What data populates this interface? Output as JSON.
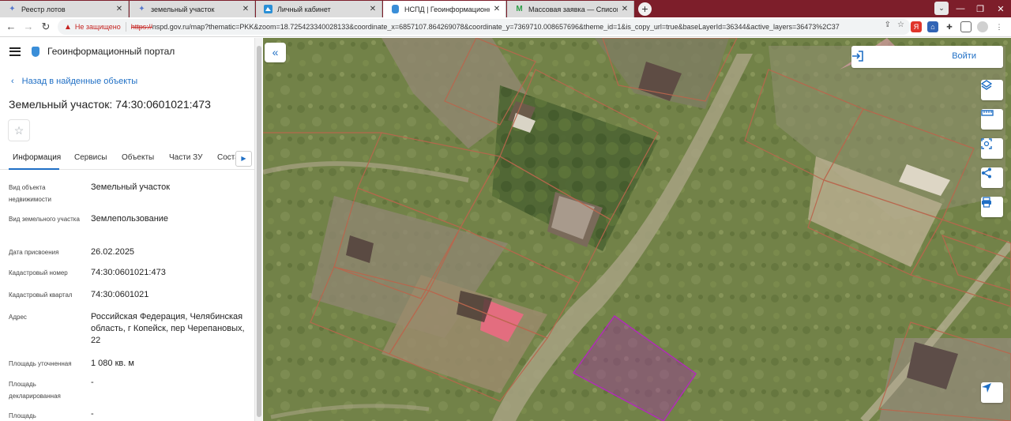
{
  "browser": {
    "tabs": [
      {
        "title": "Реестр лотов",
        "icon": "globe-icon",
        "active": false
      },
      {
        "title": "земельный участок",
        "icon": "globe-icon",
        "active": false
      },
      {
        "title": "Личный кабинет",
        "icon": "cabinet-icon",
        "active": false
      },
      {
        "title": "НСПД | Геоинформационный п",
        "icon": "portal-icon",
        "active": true
      },
      {
        "title": "Массовая заявка — Список зая",
        "icon": "gmail-icon",
        "active": false
      }
    ],
    "new_tab": "+",
    "tab_close": "✕",
    "address": {
      "security_label": "Не защищено",
      "url_scheme": "https://",
      "url_rest": "nspd.gov.ru/map?thematic=PKK&zoom=18.725423340028133&coordinate_x=6857107.864269078&coordinate_y=7369710.008657696&theme_id=1&is_copy_url=true&baseLayerId=36344&active_layers=36473%2C37"
    }
  },
  "portal": {
    "title": "Геоинформационный портал",
    "back_link": "Назад в найденные объекты",
    "object_title": "Земельный участок: 74:30:0601021:473",
    "tabs": [
      "Информация",
      "Сервисы",
      "Объекты",
      "Части ЗУ",
      "Соста"
    ],
    "properties": [
      {
        "label": "Вид объекта недвижимости",
        "value": "Земельный участок"
      },
      {
        "label": "Вид земельного участка",
        "value": "Землепользование"
      },
      {
        "label": "Дата присвоения",
        "value": "26.02.2025"
      },
      {
        "label": "Кадастровый номер",
        "value": "74:30:0601021:473"
      },
      {
        "label": "Кадастровый квартал",
        "value": "74:30:0601021"
      },
      {
        "label": "Адрес",
        "value": "Российская Федерация, Челябинская область, г Копейск, пер Черепановых, 22"
      },
      {
        "label": "Площадь уточненная",
        "value": "1 080 кв. м"
      },
      {
        "label": "Площадь декларированная",
        "value": "-"
      },
      {
        "label": "Площадь",
        "value": "-"
      }
    ]
  },
  "map": {
    "login_label": "Войти",
    "controls": [
      "layers-icon",
      "ruler-icon",
      "select-area-icon",
      "share-icon",
      "print-icon",
      "locate-icon"
    ],
    "colors": {
      "parcel_border": "#b9664d",
      "selected_parcel": "#a02aa8",
      "accent": "#1f6fc5"
    }
  }
}
